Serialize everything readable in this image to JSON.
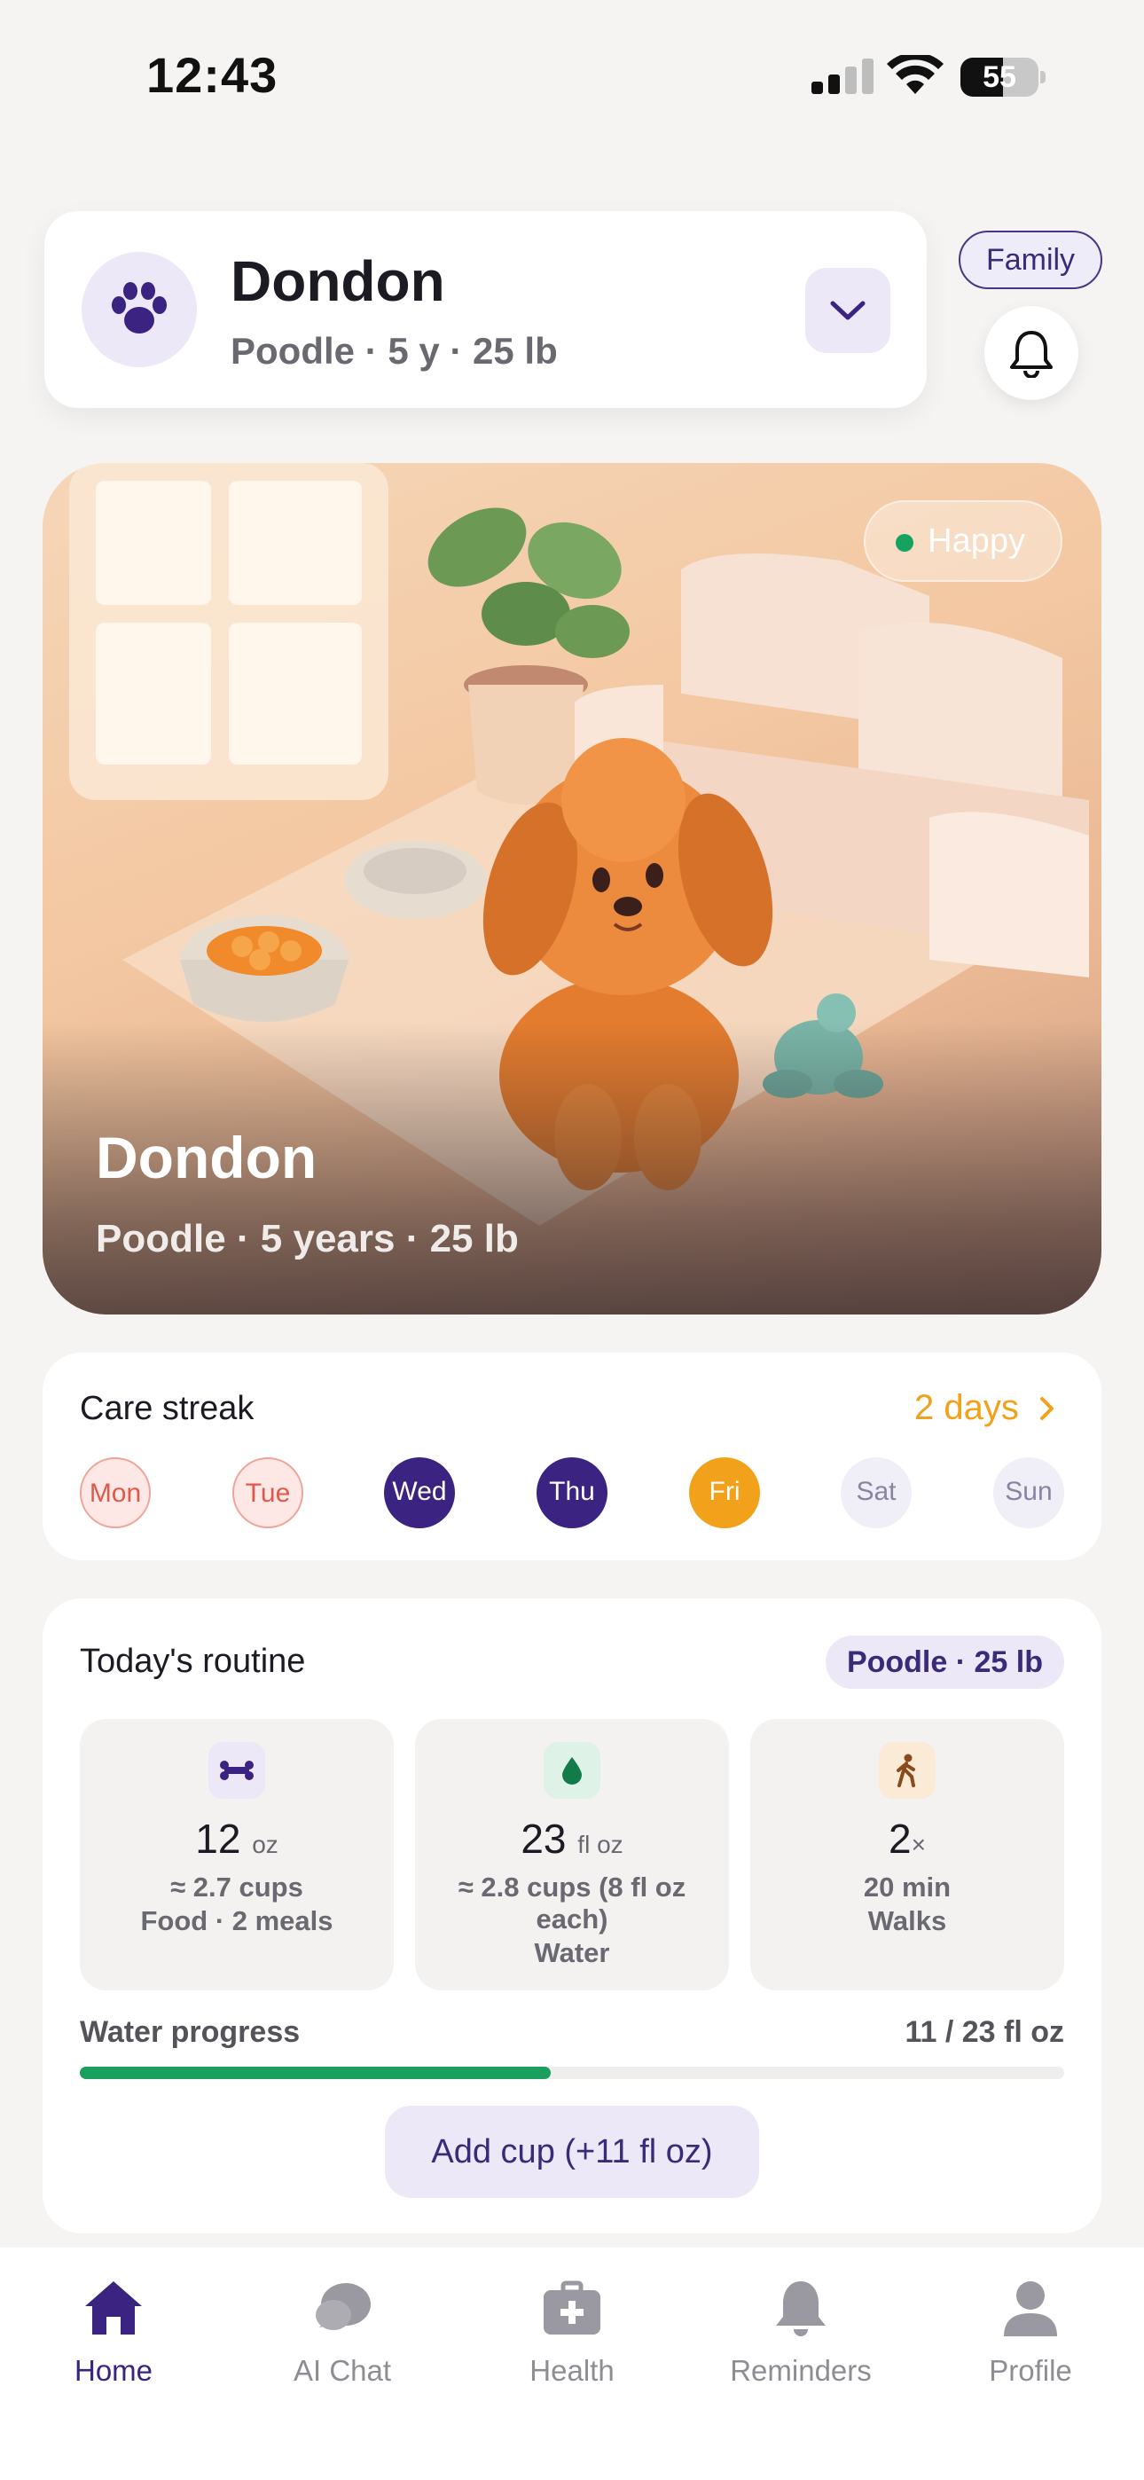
{
  "status_bar": {
    "time": "12:43",
    "battery": "55",
    "battery_level": 0.55
  },
  "pet_selector": {
    "name": "Dondon",
    "details": "Poodle · 5 y · 25 lb",
    "icon": "paw-icon",
    "dropdown_icon": "chevron-down-icon"
  },
  "header": {
    "family_label": "Family",
    "bell_icon": "bell-icon"
  },
  "hero": {
    "mood": "Happy",
    "name": "Dondon",
    "details": "Poodle · 5 years · 25 lb"
  },
  "care_streak": {
    "title": "Care streak",
    "streak_label": "2 days",
    "days": [
      {
        "label": "Mon",
        "state": "missed"
      },
      {
        "label": "Tue",
        "state": "missed"
      },
      {
        "label": "Wed",
        "state": "done"
      },
      {
        "label": "Thu",
        "state": "done"
      },
      {
        "label": "Fri",
        "state": "today"
      },
      {
        "label": "Sat",
        "state": "future"
      },
      {
        "label": "Sun",
        "state": "future"
      }
    ]
  },
  "routine": {
    "title": "Today's routine",
    "badge": "Poodle · 25 lb",
    "tiles": [
      {
        "icon": "bone-icon",
        "value": "12",
        "unit": "oz",
        "line1": "≈ 2.7 cups",
        "line2": "Food · 2 meals",
        "line3": ""
      },
      {
        "icon": "water-drop-icon",
        "value": "23",
        "unit": "fl oz",
        "line1": "≈ 2.8 cups (8 fl oz",
        "line2": "each)",
        "line3": "Water"
      },
      {
        "icon": "walking-icon",
        "value": "2",
        "unit": "×",
        "line1": "20 min",
        "line2": "Walks",
        "line3": ""
      }
    ],
    "water_progress_label": "Water progress",
    "water_progress_value": "11 / 23 fl oz",
    "water_progress_fraction": 0.478,
    "add_button": "Add cup (+11 fl oz)"
  },
  "colors": {
    "brand": "#3b2382",
    "accent": "#f2a11a",
    "success": "#1a9f5f"
  },
  "tabs": [
    {
      "label": "Home",
      "icon": "home-icon",
      "active": true
    },
    {
      "label": "AI Chat",
      "icon": "chat-icon",
      "active": false
    },
    {
      "label": "Health",
      "icon": "medical-kit-icon",
      "active": false
    },
    {
      "label": "Reminders",
      "icon": "bell-icon",
      "active": false
    },
    {
      "label": "Profile",
      "icon": "person-icon",
      "active": false
    }
  ]
}
